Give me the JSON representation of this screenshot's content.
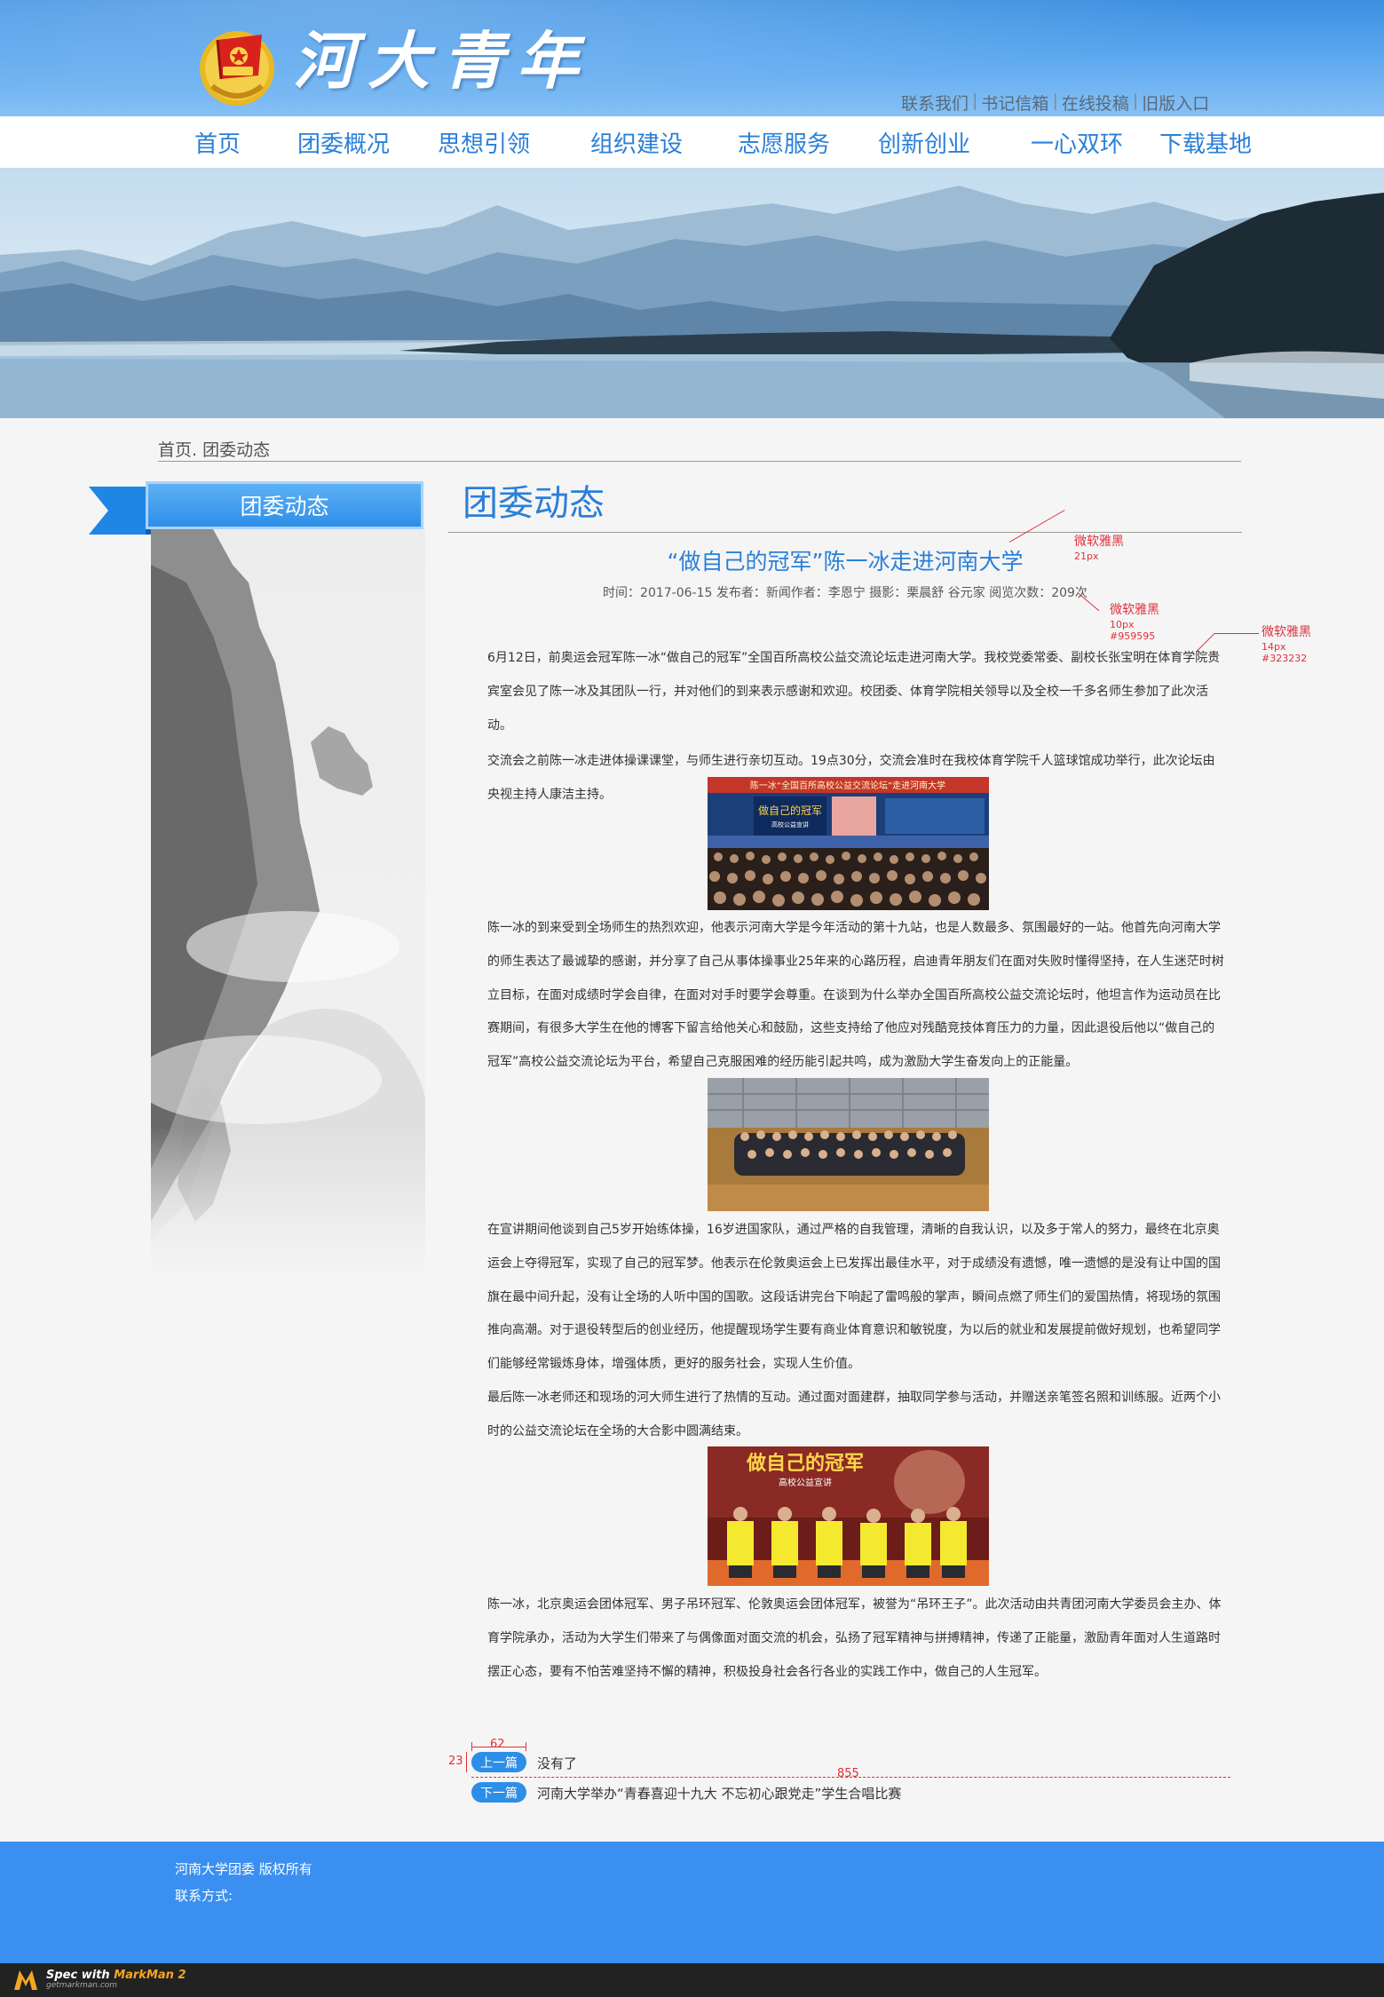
{
  "header": {
    "logo_text": "河大青年",
    "top_links": [
      "联系我们",
      "书记信箱",
      "在线投稿",
      "旧版入口"
    ],
    "top_link_separator": "|"
  },
  "nav": {
    "items": [
      "首页",
      "团委概况",
      "思想引领",
      "组织建设",
      "志愿服务",
      "创新创业",
      "一心双环",
      "下载基地"
    ]
  },
  "breadcrumb": "首页. 团委动态",
  "sidebar": {
    "title": "团委动态"
  },
  "main": {
    "section_title": "团委动态",
    "article": {
      "title": "“做自己的冠军”陈一冰走进河南大学",
      "meta": "时间：2017-06-15 发布者：新闻作者：李恩宁 摄影：栗晨舒 谷元家 阅览次数：209次",
      "paragraphs": [
        "6月12日，前奥运会冠军陈一冰“做自己的冠军”全国百所高校公益交流论坛走进河南大学。我校党委常委、副校长张宝明在体育学院贵宾室会见了陈一冰及其团队一行，并对他们的到来表示感谢和欢迎。校团委、体育学院相关领导以及全校一千多名师生参加了此次活动。",
        "交流会之前陈一冰走进体操课课堂，与师生进行亲切互动。19点30分，交流会准时在我校体育学院千人篮球馆成功举行，此次论坛由央视主持人康洁主持。",
        "陈一冰的到来受到全场师生的热烈欢迎，他表示河南大学是今年活动的第十九站，也是人数最多、氛围最好的一站。他首先向河南大学的师生表达了最诚挚的感谢，并分享了自己从事体操事业25年来的心路历程，启迪青年朋友们在面对失败时懂得坚持，在人生迷茫时树立目标，在面对成绩时学会自律，在面对对手时要学会尊重。在谈到为什么举办全国百所高校公益交流论坛时，他坦言作为运动员在比赛期间，有很多大学生在他的博客下留言给他关心和鼓励，这些支持给了他应对残酷竞技体育压力的力量，因此退役后他以“做自己的冠军”高校公益交流论坛为平台，希望自己克服困难的经历能引起共鸣，成为激励大学生奋发向上的正能量。",
        "在宣讲期间他谈到自己5岁开始练体操，16岁进国家队，通过严格的自我管理，清晰的自我认识，以及多于常人的努力，最终在北京奥运会上夺得冠军，实现了自己的冠军梦。他表示在伦敦奥运会上已发挥出最佳水平，对于成绩没有遗憾，唯一遗憾的是没有让中国的国旗在最中间升起，没有让全场的人听中国的国歌。这段话讲完台下响起了雷鸣般的掌声，瞬间点燃了师生们的爱国热情，将现场的氛围推向高潮。对于退役转型后的创业经历，他提醒现场学生要有商业体育意识和敏锐度，为以后的就业和发展提前做好规划，也希望同学们能够经常锻炼身体，增强体质，更好的服务社会，实现人生价值。",
        "最后陈一冰老师还和现场的河大师生进行了热情的互动。通过面对面建群，抽取同学参与活动，并赠送亲笔签名照和训练服。近两个小时的公益交流论坛在全场的大合影中圆满结束。",
        "陈一冰，北京奥运会团体冠军、男子吊环冠军、伦敦奥运会团体冠军，被誉为“吊环王子”。此次活动由共青团河南大学委员会主办、体育学院承办，活动为大学生们带来了与偶像面对面交流的机会，弘扬了冠军精神与拼搏精神，传递了正能量，激励青年面对人生道路时摆正心态，要有不怕苦难坚持不懈的精神，积极投身社会各行各业的实践工作中，做自己的人生冠军。"
      ],
      "photo1": {
        "banner": "陈一冰“全国百所高校公益交流论坛”走进河南大学",
        "screen_title": "做自己的冠军",
        "screen_sub": "高校公益宣讲"
      },
      "photo3": {
        "title": "做自己的冠军",
        "sub": "高校公益宣讲"
      }
    },
    "prev": {
      "label": "上一篇",
      "text": "没有了"
    },
    "next": {
      "label": "下一篇",
      "text": "河南大学举办“青春喜迎十九大 不忘初心跟党走”学生合唱比赛"
    }
  },
  "annotations": {
    "title_font": {
      "font": "微软雅黑",
      "size": "21px"
    },
    "meta_font": {
      "font": "微软雅黑",
      "size": "10px",
      "color": "#959595"
    },
    "body_font": {
      "font": "微软雅黑",
      "size": "14px",
      "color": "#323232"
    },
    "badge_width": "62",
    "badge_height": "23",
    "list_width": "855"
  },
  "footer": {
    "copyright": "河南大学团委  版权所有",
    "contact": "联系方式:"
  },
  "markman": {
    "spec_with": "Spec with ",
    "brand": "MarkMan 2",
    "url": "getmarkman.com"
  },
  "colors": {
    "accent": "#2a7fd8",
    "footer": "#3a8ff0",
    "annotation": "#e0303a"
  }
}
